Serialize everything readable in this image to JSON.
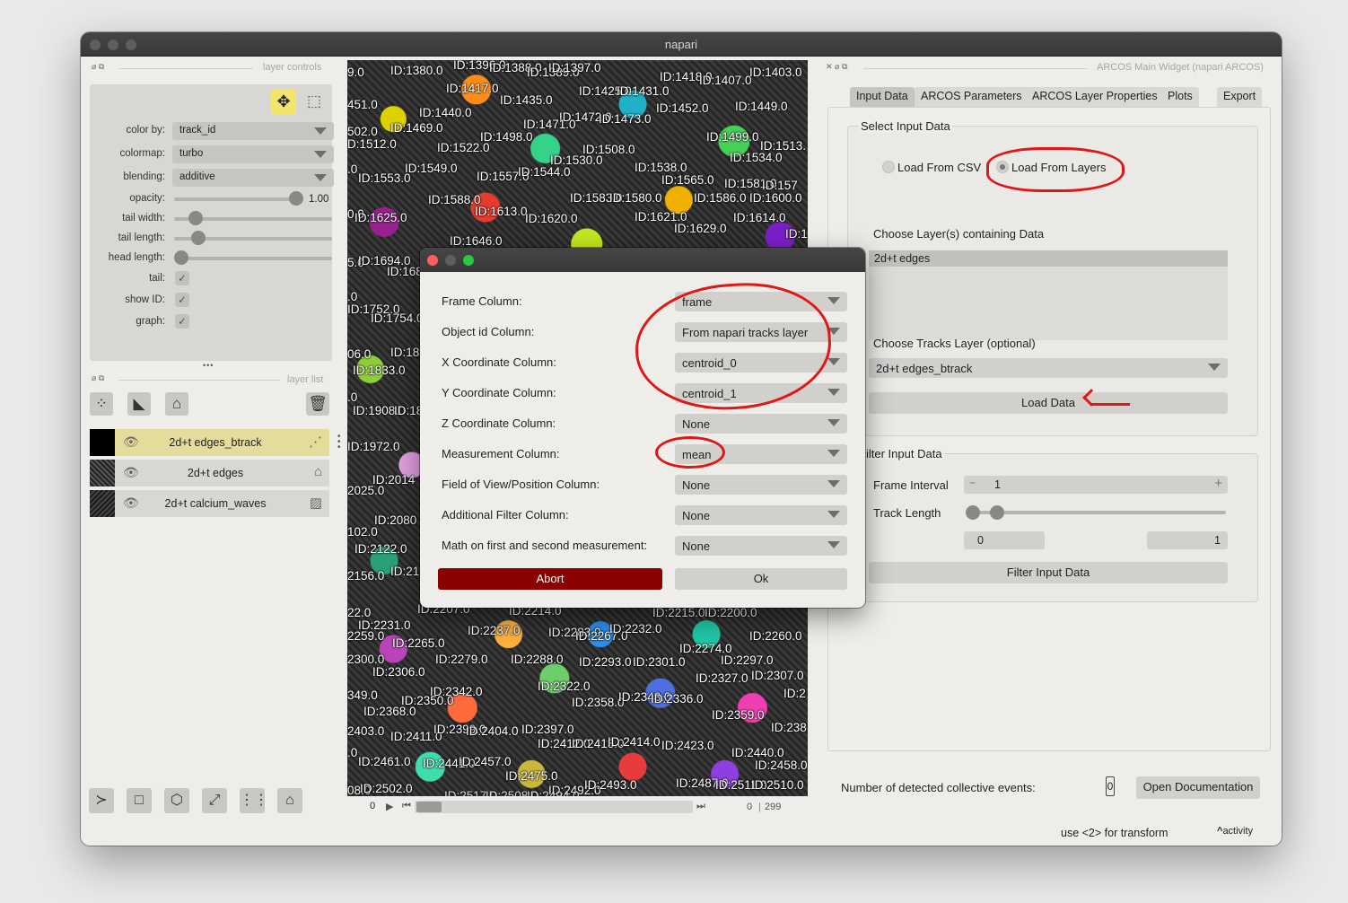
{
  "window": {
    "title": "napari"
  },
  "left_panel": {
    "layer_controls_title": "layer controls",
    "layer_list_title": "layer list",
    "controls": {
      "color_by_label": "color by:",
      "color_by_value": "track_id",
      "colormap_label": "colormap:",
      "colormap_value": "turbo",
      "blending_label": "blending:",
      "blending_value": "additive",
      "opacity_label": "opacity:",
      "opacity_value": "1.00",
      "opacity_level": 1.0,
      "tail_width_label": "tail width:",
      "tail_width_level": 0.1,
      "tail_length_label": "tail length:",
      "tail_length_level": 0.12,
      "head_length_label": "head length:",
      "head_length_level": 0.0,
      "tail_label": "tail:",
      "show_id_label": "show ID:",
      "graph_label": "graph:",
      "check_glyph": "✓"
    },
    "more_glyph": "•••",
    "layers": [
      {
        "name": "2d+t edges_btrack",
        "selected": true
      },
      {
        "name": "2d+t edges",
        "selected": false
      },
      {
        "name": "2d+t calcium_waves",
        "selected": false
      }
    ]
  },
  "canvas": {
    "labels": [
      [
        "ID:1380.0",
        48,
        4
      ],
      [
        "ID:1396.0",
        118,
        -2
      ],
      [
        "ID:1388.0",
        158,
        1
      ],
      [
        "ID:1389.0",
        200,
        6
      ],
      [
        "ID:1397.0",
        224,
        1
      ],
      [
        "ID:1418.0",
        348,
        11
      ],
      [
        "ID:1407.0",
        392,
        15
      ],
      [
        "ID:1403.0",
        448,
        6
      ],
      [
        "9.0",
        0,
        6
      ],
      [
        "ID:1417.0",
        110,
        24
      ],
      [
        "ID:1425.0",
        258,
        27
      ],
      [
        "ID:1431.0",
        300,
        27
      ],
      [
        "451.0",
        0,
        42
      ],
      [
        "ID:1435.0",
        170,
        37
      ],
      [
        "ID:1440.0",
        80,
        51
      ],
      [
        "ID:1452.0",
        344,
        46
      ],
      [
        "ID:1449.0",
        432,
        44
      ],
      [
        "502.0",
        0,
        72
      ],
      [
        "ID:1469.0",
        48,
        68
      ],
      [
        "ID:1472.0",
        236,
        56
      ],
      [
        "ID:1473.0",
        280,
        58
      ],
      [
        "ID:1471.0",
        196,
        64
      ],
      [
        "D:1512.0",
        0,
        86
      ],
      [
        "ID:1498.0",
        148,
        78
      ],
      [
        "ID:1522.0",
        100,
        90
      ],
      [
        "ID:1508.0",
        262,
        92
      ],
      [
        "ID:1499.0",
        400,
        78
      ],
      [
        "ID:1513.",
        460,
        88
      ],
      [
        "ID:1530.0",
        226,
        104
      ],
      [
        "ID:1534.0",
        426,
        101
      ],
      [
        ".0",
        0,
        114
      ],
      [
        "ID:1549.0",
        64,
        113
      ],
      [
        "ID:1557.0",
        144,
        122
      ],
      [
        "ID:1544.0",
        190,
        117
      ],
      [
        "ID:1538.0",
        320,
        112
      ],
      [
        "ID:1565.0",
        350,
        126
      ],
      [
        "ID:1581.0",
        420,
        130
      ],
      [
        "ID:157",
        462,
        132
      ],
      [
        "ID:1553.0",
        12,
        124
      ],
      [
        "ID:1588.0",
        90,
        148
      ],
      [
        "ID:1583.0",
        248,
        146
      ],
      [
        "ID:1580.0",
        292,
        146
      ],
      [
        "ID:1586.0",
        386,
        146
      ],
      [
        "ID:1600.0",
        448,
        146
      ],
      [
        "0.0",
        0,
        164
      ],
      [
        "ID:1613.0",
        142,
        161
      ],
      [
        "ID:1625.0",
        8,
        168
      ],
      [
        "ID:1620.0",
        198,
        169
      ],
      [
        "ID:1621.0",
        320,
        167
      ],
      [
        "ID:1614.0",
        430,
        168
      ],
      [
        "ID:1629.0",
        364,
        180
      ],
      [
        "ID:1646.0",
        114,
        194
      ],
      [
        "ID:1",
        488,
        186
      ],
      [
        "5.0",
        0,
        218
      ],
      [
        "ID:1694.0",
        12,
        216
      ],
      [
        "ID:168",
        44,
        228
      ],
      [
        ".0",
        0,
        256
      ],
      [
        "ID:1752.0",
        0,
        270
      ],
      [
        "ID:1754.0",
        26,
        280
      ],
      [
        "06.0",
        0,
        320
      ],
      [
        "ID:18",
        48,
        318
      ],
      [
        "ID:1833.0",
        6,
        338
      ],
      [
        ".0",
        0,
        368
      ],
      [
        "ID:1908.0",
        6,
        383
      ],
      [
        "ID:18",
        52,
        383
      ],
      [
        "ID:1972.0",
        0,
        423
      ],
      [
        "ID:2014",
        28,
        460
      ],
      [
        "2025.0",
        0,
        472
      ],
      [
        "ID:2080",
        30,
        505
      ],
      [
        "102.0",
        0,
        518
      ],
      [
        "ID:2122.0",
        8,
        537
      ],
      [
        "2156.0",
        0,
        567
      ],
      [
        "ID:21",
        48,
        562
      ],
      [
        "22.0",
        0,
        608
      ],
      [
        "ID:2207.0",
        78,
        604
      ],
      [
        "ID:2214.0",
        180,
        606
      ],
      [
        "ID:2215.0",
        340,
        608
      ],
      [
        "ID:2200.0",
        398,
        608
      ],
      [
        "ID:2231.0",
        12,
        622
      ],
      [
        "2259.0",
        0,
        634
      ],
      [
        "ID:2265.0",
        50,
        642
      ],
      [
        "ID:2237.0",
        134,
        628
      ],
      [
        "ID:2283.0",
        224,
        630
      ],
      [
        "ID:2267.0",
        254,
        634
      ],
      [
        "ID:2232.0",
        292,
        626
      ],
      [
        "ID:2260.0",
        448,
        634
      ],
      [
        "ID:2274.0",
        370,
        648
      ],
      [
        "2300.0",
        0,
        660
      ],
      [
        "ID:2306.0",
        28,
        674
      ],
      [
        "ID:2279.0",
        98,
        660
      ],
      [
        "ID:2288.0",
        182,
        660
      ],
      [
        "ID:2293.0",
        258,
        663
      ],
      [
        "ID:2301.0",
        318,
        663
      ],
      [
        "ID:2297.0",
        416,
        661
      ],
      [
        "ID:2327.0",
        388,
        681
      ],
      [
        "ID:2307.0",
        450,
        678
      ],
      [
        "ID:2342.0",
        92,
        696
      ],
      [
        "ID:2322.0",
        212,
        690
      ],
      [
        "ID:2358.0",
        250,
        708
      ],
      [
        "ID:2343.0",
        302,
        702
      ],
      [
        "ID:2336.0",
        338,
        704
      ],
      [
        "349.0",
        0,
        700
      ],
      [
        "ID:2350.0",
        60,
        706
      ],
      [
        "ID:2368.0",
        18,
        718
      ],
      [
        "ID:2",
        486,
        698
      ],
      [
        "ID:2359.0",
        406,
        722
      ],
      [
        "ID:238",
        472,
        736
      ],
      [
        "2403.0",
        0,
        740
      ],
      [
        "ID:2411.0",
        48,
        746
      ],
      [
        "ID:2399.0",
        96,
        738
      ],
      [
        "ID:2404.0",
        132,
        740
      ],
      [
        "ID:2397.0",
        194,
        738
      ],
      [
        "ID:2412.0",
        212,
        754
      ],
      [
        "ID:2413.0",
        250,
        754
      ],
      [
        "ID:2414.0",
        290,
        752
      ],
      [
        "ID:2423.0",
        350,
        756
      ],
      [
        "ID:2440.0",
        428,
        764
      ],
      [
        ".0",
        0,
        764
      ],
      [
        "ID:2461.0",
        12,
        774
      ],
      [
        "ID:2441.0",
        84,
        776
      ],
      [
        "ID:2457.0",
        124,
        774
      ],
      [
        "ID:2458.0",
        454,
        778
      ],
      [
        "ID:2475.0",
        176,
        790
      ],
      [
        "08.0",
        0,
        806
      ],
      [
        "ID:2502.0",
        14,
        804
      ],
      [
        "ID:2492.0",
        224,
        806
      ],
      [
        "ID:2493.0",
        264,
        800
      ],
      [
        "ID:2487.0",
        366,
        798
      ],
      [
        "ID:2511.0",
        410,
        800
      ],
      [
        "ID:2510.0",
        450,
        800
      ]
    ],
    "bottom_labels": [
      "ID:2517.0",
      "ID:2508.0",
      "ID:2494.0"
    ]
  },
  "slider": {
    "start_value": "0",
    "current_value": "0",
    "max_value": "299",
    "position_level": 0.0
  },
  "dialog": {
    "rows": [
      {
        "label": "Frame Column:",
        "value": "frame"
      },
      {
        "label": "Object id Column:",
        "value": "From napari tracks layer"
      },
      {
        "label": "X Coordinate Column:",
        "value": "centroid_0"
      },
      {
        "label": "Y Coordinate Column:",
        "value": "centroid_1"
      },
      {
        "label": "Z Coordinate Column:",
        "value": "None"
      },
      {
        "label": "Measurement Column:",
        "value": "mean"
      },
      {
        "label": "Field of View/Position Column:",
        "value": "None"
      },
      {
        "label": "Additional Filter Column:",
        "value": "None"
      },
      {
        "label": "Math on first and second measurement:",
        "value": "None"
      }
    ],
    "abort_label": "Abort",
    "ok_label": "Ok"
  },
  "right_panel": {
    "title": "ARCOS Main Widget (napari ARCOS)",
    "tabs": [
      "Input Data",
      "ARCOS Parameters",
      "ARCOS Layer Properties",
      "Plots",
      "Export"
    ],
    "active_tab": 0,
    "select_input_title": "Select Input Data",
    "load_csv_label": "Load From CSV",
    "load_layers_label": "Load From Layers",
    "choose_layers_label": "Choose Layer(s) containing Data",
    "layer_list_items": [
      "2d+t edges"
    ],
    "choose_tracks_label": "Choose Tracks Layer (optional)",
    "tracks_layer_value": "2d+t edges_btrack",
    "load_data_label": "Load Data",
    "filter_title": "ilter Input Data",
    "frame_interval_label": "Frame Interval",
    "frame_interval_value": "1",
    "minus_glyph": "−",
    "plus_glyph": "+",
    "track_length_label": "Track Length",
    "track_length_min": "0",
    "track_length_max": "1",
    "filter_button_label": "Filter Input Data",
    "events_label": "Number of detected collective events:",
    "events_value": "0",
    "open_docs_label": "Open Documentation"
  },
  "status_bar": {
    "message": "use <2> for transform",
    "activity_label": "activity",
    "activity_glyph": "^"
  },
  "colors": {
    "abort_bg": "#8b0000",
    "annotation_red": "#e01717",
    "selected_layer_bg": "#e4dc9b",
    "selected_tool_bg": "#f3e46a"
  }
}
